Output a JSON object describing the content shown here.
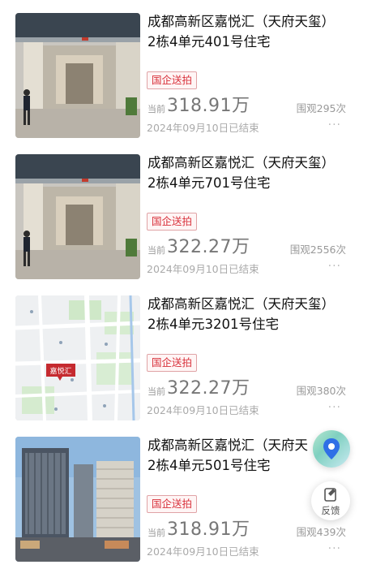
{
  "listings": [
    {
      "title_line1": "成都高新区嘉悦汇（天府天玺）",
      "title_line2": "2栋4单元401号住宅",
      "badge": "国企送拍",
      "price_prefix": "当前",
      "price": "318.91万",
      "views": "围观295次",
      "end_time": "2024年09月10日已结束",
      "more": "···",
      "image": "building-lobby-photo"
    },
    {
      "title_line1": "成都高新区嘉悦汇（天府天玺）",
      "title_line2": "2栋4单元701号住宅",
      "badge": "国企送拍",
      "price_prefix": "当前",
      "price": "322.27万",
      "views": "围观2556次",
      "end_time": "2024年09月10日已结束",
      "more": "···",
      "image": "building-lobby-photo"
    },
    {
      "title_line1": "成都高新区嘉悦汇（天府天玺）",
      "title_line2": "2栋4单元3201号住宅",
      "badge": "国企送拍",
      "price_prefix": "当前",
      "price": "322.27万",
      "views": "围观380次",
      "end_time": "2024年09月10日已结束",
      "more": "···",
      "image": "location-map",
      "map_label": "嘉悦汇"
    },
    {
      "title_line1": "成都高新区嘉悦汇（天府天",
      "title_line2": "2栋4单元501号住宅",
      "badge": "国企送拍",
      "price_prefix": "当前",
      "price": "318.91万",
      "views": "围观439次",
      "end_time": "2024年09月10日已结束",
      "more": "···",
      "image": "tower-exterior-photo"
    }
  ],
  "fab": {
    "map_icon": "map-pin-icon",
    "feedback_icon": "edit-note-icon",
    "feedback_label": "反馈"
  },
  "colors": {
    "badge_text": "#d8303a",
    "badge_border": "#e0a3a6"
  }
}
